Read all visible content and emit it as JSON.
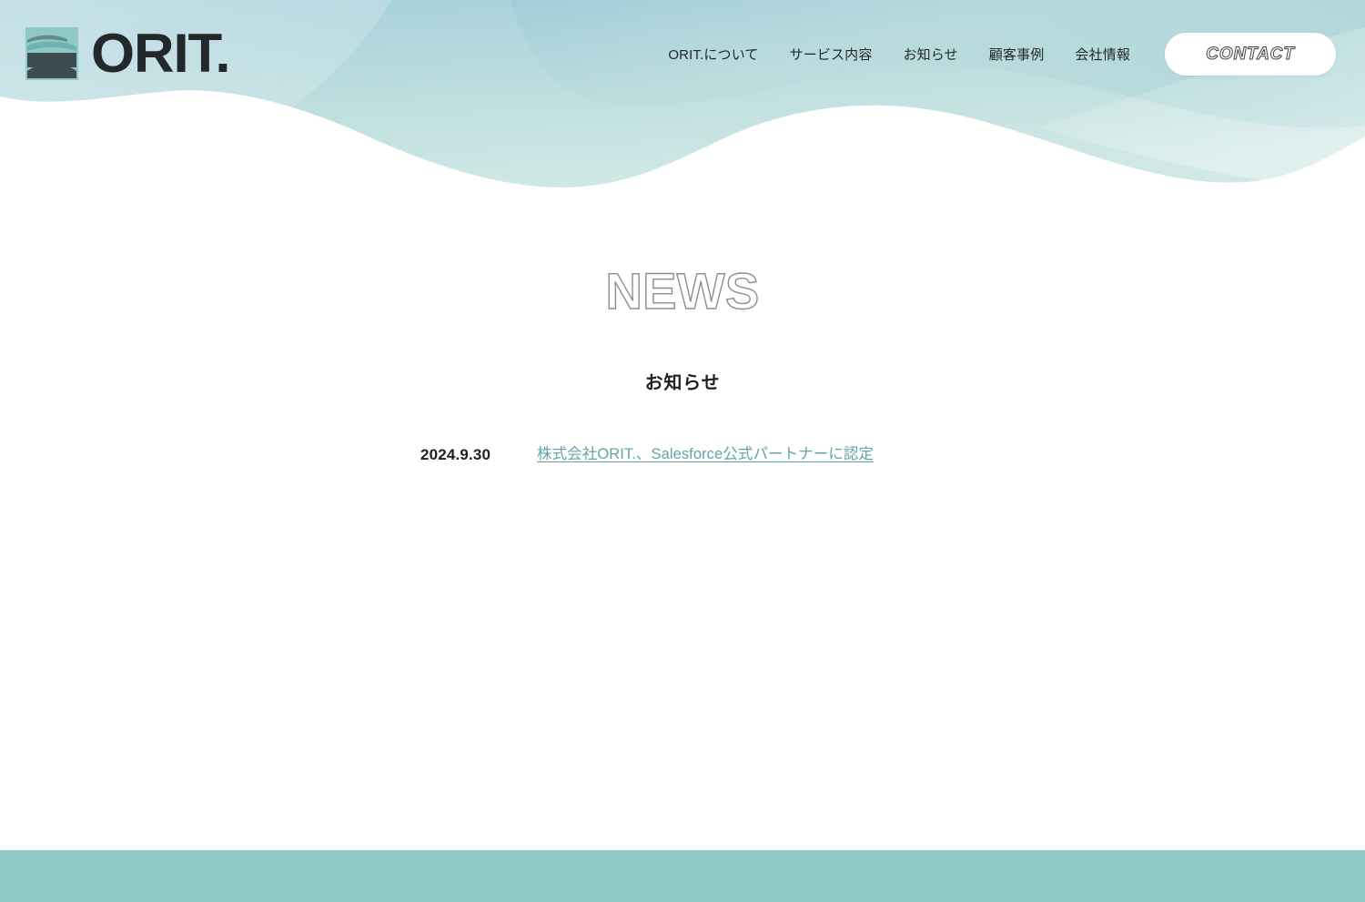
{
  "site": {
    "brand_word": "ORIT.",
    "brand_mark_icon": "orit-wave-square-logo"
  },
  "header": {
    "nav": [
      {
        "label": "ORIT.について",
        "name": "nav-about"
      },
      {
        "label": "サービス内容",
        "name": "nav-services"
      },
      {
        "label": "お知らせ",
        "name": "nav-news"
      },
      {
        "label": "顧客事例",
        "name": "nav-cases"
      },
      {
        "label": "会社情報",
        "name": "nav-company"
      }
    ],
    "contact_button": "CONTACT"
  },
  "page": {
    "title_en": "NEWS",
    "subtitle_ja": "お知らせ"
  },
  "news": {
    "items": [
      {
        "date": "2024.9.30",
        "title": "株式会社ORIT.、Salesforce公式パートナーに認定"
      }
    ]
  },
  "colors": {
    "hero_top": "#a9cfda",
    "hero_mid": "#c3e0e0",
    "hero_light": "#dff0ef",
    "accent_teal": "#8ec9c6",
    "link_teal": "#64a3a6",
    "ink": "#23282a",
    "outline_gray": "#8b8f92"
  }
}
